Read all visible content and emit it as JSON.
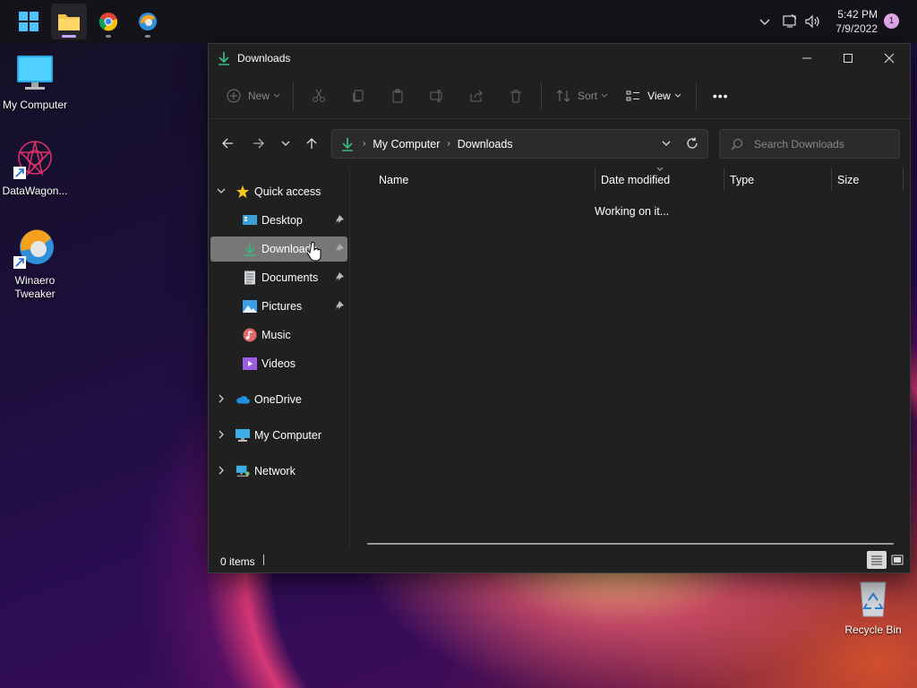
{
  "taskbar": {
    "apps": [
      {
        "name": "start-button"
      },
      {
        "name": "file-explorer-button"
      },
      {
        "name": "chrome-button"
      },
      {
        "name": "winaero-tweaker-button"
      }
    ],
    "clock_time": "5:42 PM",
    "clock_date": "7/9/2022",
    "notification_count": "1"
  },
  "desktop": {
    "icons": [
      {
        "label": "My Computer"
      },
      {
        "label": "DataWagon..."
      },
      {
        "label": "Winaero Tweaker"
      },
      {
        "label": "Recycle Bin"
      }
    ]
  },
  "window": {
    "title": "Downloads",
    "commands": {
      "new_label": "New",
      "sort_label": "Sort",
      "view_label": "View",
      "more_label": "•••"
    },
    "address": {
      "segments": [
        "My Computer",
        "Downloads"
      ]
    },
    "search": {
      "placeholder": "Search Downloads"
    },
    "nav": {
      "quick_access": "Quick access",
      "items": [
        {
          "label": "Desktop",
          "pinned": true
        },
        {
          "label": "Downloads",
          "pinned": true,
          "selected": true
        },
        {
          "label": "Documents",
          "pinned": true
        },
        {
          "label": "Pictures",
          "pinned": true
        },
        {
          "label": "Music",
          "pinned": false
        },
        {
          "label": "Videos",
          "pinned": false
        }
      ],
      "onedrive": "OneDrive",
      "my_computer": "My Computer",
      "network": "Network"
    },
    "columns": {
      "name": "Name",
      "date_modified": "Date modified",
      "type": "Type",
      "size": "Size"
    },
    "content_message": "Working on it...",
    "status": {
      "items_count": "0 items"
    }
  },
  "colors": {
    "accent_green": "#3bb47e",
    "window_bg": "#202020",
    "selection_bg": "#777777"
  }
}
